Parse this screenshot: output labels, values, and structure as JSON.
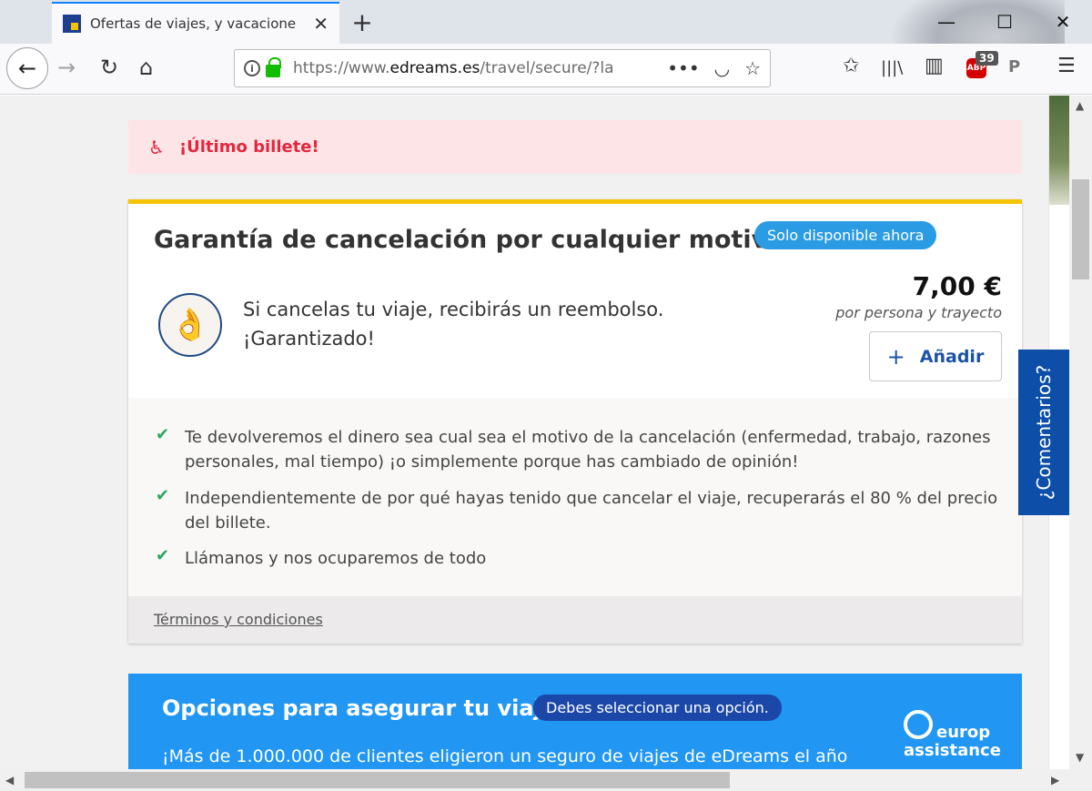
{
  "browser": {
    "tab_title": "Ofertas de viajes, y vacaciones",
    "tab_close": "✕",
    "new_tab": "+",
    "win_minimize": "—",
    "win_maximize": "☐",
    "win_close": "✕",
    "back": "←",
    "forward": "→",
    "reload": "↻",
    "home": "⌂",
    "info": "i",
    "url_prefix": "https://www.",
    "url_domain": "edreams.es",
    "url_path": "/travel/secure/?la",
    "url_more": "•••",
    "pocket": "◡",
    "bookmark": "☆",
    "bookmarks_star": "✩",
    "library": "|||\\",
    "sidebar_toggle": "▥",
    "abp_label": "ABP",
    "abp_count": "39",
    "pinterest": "P",
    "menu": "☰"
  },
  "alert": {
    "icon": "seat-icon",
    "text": "¡Último billete!"
  },
  "cancellation": {
    "title": "Garantía de cancelación por cualquier motivo",
    "badge": "Solo disponible ahora",
    "intro_line1": "Si cancelas tu viaje, recibirás un reembolso.",
    "intro_line2": "¡Garantizado!",
    "price": "7,00 €",
    "price_note": "por persona y trayecto",
    "add_icon": "+",
    "add_label": "Añadir",
    "benefits": [
      "Te devolveremos el dinero sea cual sea el motivo de la cancelación (enfermedad, trabajo, razones personales, mal tiempo) ¡o simplemente porque has cambiado de opinión!",
      "Independientemente de por qué hayas tenido que cancelar el viaje, recuperarás el 80 % del precio del billete.",
      "Llámanos y nos ocuparemos de todo"
    ],
    "check_glyph": "✔",
    "terms": "Términos y condiciones"
  },
  "insurance": {
    "title": "Opciones para asegurar tu viaje",
    "badge": "Debes seleccionar una opción.",
    "text": "¡Más de 1.000.000 de clientes eligieron un seguro de viajes de eDreams el año",
    "logo_line1": "europ",
    "logo_line2": "assistance"
  },
  "feedback_tab": "¿Comentarios?",
  "scroll": {
    "up": "▲",
    "down": "▼",
    "left": "◀",
    "right": "▶"
  },
  "colors": {
    "accent_yellow": "#f6c300",
    "alert_red": "#e3263d",
    "check_green": "#27a85e",
    "button_blue": "#1c52a8",
    "insurance_blue": "#2196f3"
  }
}
